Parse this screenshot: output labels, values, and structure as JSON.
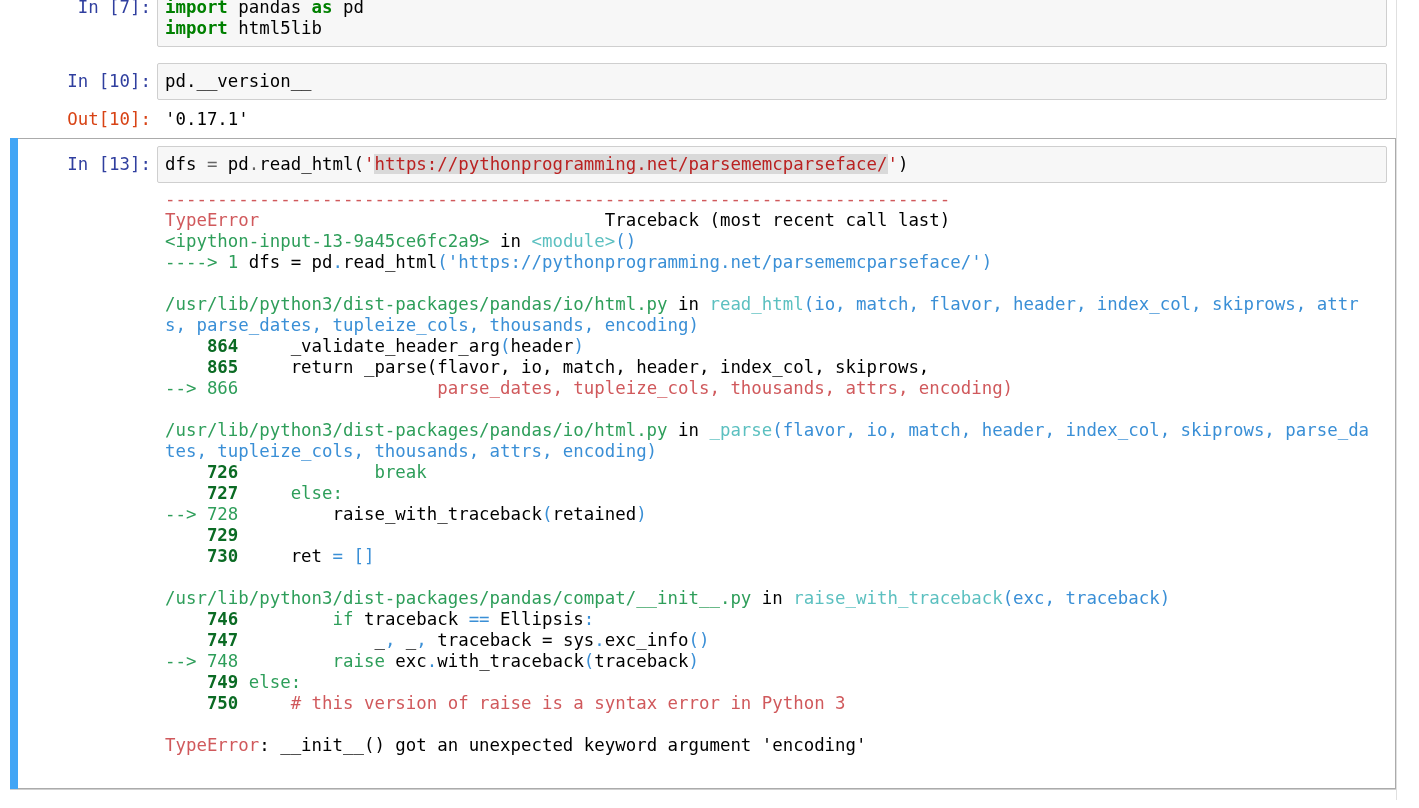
{
  "cells": [
    {
      "selected": false,
      "prompt": "In [7]:",
      "input": [
        [
          {
            "kind": "kw",
            "text": "import"
          },
          {
            "kind": "plain",
            "text": " pandas "
          },
          {
            "kind": "kw",
            "text": "as"
          },
          {
            "kind": "plain",
            "text": " pd"
          }
        ],
        [
          {
            "kind": "kw",
            "text": "import"
          },
          {
            "kind": "plain",
            "text": " html5lib"
          }
        ]
      ]
    },
    {
      "selected": false,
      "prompt": "In [10]:",
      "input": [
        [
          {
            "kind": "plain",
            "text": "pd."
          },
          {
            "kind": "plain",
            "text": "__version__"
          }
        ]
      ],
      "output": {
        "prompt": "Out[10]:",
        "lines": [
          "'0.17.1'"
        ]
      }
    },
    {
      "selected": true,
      "prompt": "In [13]:",
      "input": [
        [
          {
            "kind": "plain",
            "text": "dfs "
          },
          {
            "kind": "op",
            "text": "="
          },
          {
            "kind": "plain",
            "text": " pd"
          },
          {
            "kind": "op",
            "text": "."
          },
          {
            "kind": "plain",
            "text": "read_html("
          },
          {
            "kind": "str",
            "text": "'"
          },
          {
            "kind": "str-hl",
            "text": "https://pythonprogramming.net/parsememcparseface/"
          },
          {
            "kind": "str",
            "text": "'"
          },
          {
            "kind": "plain",
            "text": ")"
          }
        ]
      ],
      "traceback": [
        [
          [
            {
              "kind": "red",
              "text": "---------------------------------------------------------------------------"
            }
          ],
          [
            {
              "kind": "red",
              "text": "TypeError"
            },
            {
              "kind": "plain",
              "text": "                                 Traceback (most recent call last)"
            }
          ],
          [
            {
              "kind": "green",
              "text": "<ipython-input-13-9a45ce6fc2a9>"
            },
            {
              "kind": "plain",
              "text": " in "
            },
            {
              "kind": "cyan",
              "text": "<module>"
            },
            {
              "kind": "blue",
              "text": "()"
            }
          ],
          [
            {
              "kind": "green",
              "text": "----> 1"
            },
            {
              "kind": "plain",
              "text": " dfs = pd"
            },
            {
              "kind": "blue",
              "text": "."
            },
            {
              "kind": "plain",
              "text": "read_html"
            },
            {
              "kind": "blue",
              "text": "('https://pythonprogramming.net/parsememcparseface/')"
            }
          ]
        ],
        [
          [
            {
              "kind": "green",
              "text": "/usr/lib/python3/dist-packages/pandas/io/html.py"
            },
            {
              "kind": "plain",
              "text": " in "
            },
            {
              "kind": "cyan",
              "text": "read_html"
            },
            {
              "kind": "blue",
              "text": "(io, match, flavor, header, index_col, skiprows, attr"
            }
          ],
          [
            {
              "kind": "blue",
              "text": "s, parse_dates, tupleize_cols, thousands, encoding)"
            }
          ],
          [
            {
              "kind": "lineno",
              "text": "    864"
            },
            {
              "kind": "plain",
              "text": "     _validate_header_arg"
            },
            {
              "kind": "blue",
              "text": "("
            },
            {
              "kind": "plain",
              "text": "header"
            },
            {
              "kind": "blue",
              "text": ")"
            }
          ],
          [
            {
              "kind": "lineno",
              "text": "    865"
            },
            {
              "kind": "plain",
              "text": "     return _parse(flavor, io, match, header, index_col, skiprows,"
            }
          ],
          [
            {
              "kind": "green",
              "text": "--> 866"
            },
            {
              "kind": "red",
              "text": "                   parse_dates, tupleize_cols, thousands, attrs, encoding)"
            }
          ]
        ],
        [
          [
            {
              "kind": "green",
              "text": "/usr/lib/python3/dist-packages/pandas/io/html.py"
            },
            {
              "kind": "plain",
              "text": " in "
            },
            {
              "kind": "cyan",
              "text": "_parse"
            },
            {
              "kind": "blue",
              "text": "(flavor, io, match, header, index_col, skiprows, parse_da"
            }
          ],
          [
            {
              "kind": "blue",
              "text": "tes, tupleize_cols, thousands, attrs, encoding)"
            }
          ],
          [
            {
              "kind": "lineno",
              "text": "    726"
            },
            {
              "kind": "green",
              "text": "             break"
            }
          ],
          [
            {
              "kind": "lineno",
              "text": "    727"
            },
            {
              "kind": "green",
              "text": "     else:"
            }
          ],
          [
            {
              "kind": "green",
              "text": "--> 728"
            },
            {
              "kind": "plain",
              "text": "         raise_with_traceback"
            },
            {
              "kind": "blue",
              "text": "("
            },
            {
              "kind": "plain",
              "text": "retained"
            },
            {
              "kind": "blue",
              "text": ")"
            }
          ],
          [
            {
              "kind": "lineno",
              "text": "    729"
            }
          ],
          [
            {
              "kind": "lineno",
              "text": "    730"
            },
            {
              "kind": "plain",
              "text": "     ret "
            },
            {
              "kind": "blue",
              "text": "= []"
            }
          ]
        ],
        [
          [
            {
              "kind": "green",
              "text": "/usr/lib/python3/dist-packages/pandas/compat/__init__.py"
            },
            {
              "kind": "plain",
              "text": " in "
            },
            {
              "kind": "cyan",
              "text": "raise_with_traceback"
            },
            {
              "kind": "blue",
              "text": "(exc, traceback)"
            }
          ],
          [
            {
              "kind": "lineno",
              "text": "    746"
            },
            {
              "kind": "green",
              "text": "         if"
            },
            {
              "kind": "plain",
              "text": " traceback "
            },
            {
              "kind": "blue",
              "text": "=="
            },
            {
              "kind": "plain",
              "text": " Ellipsis"
            },
            {
              "kind": "blue",
              "text": ":"
            }
          ],
          [
            {
              "kind": "lineno",
              "text": "    747"
            },
            {
              "kind": "plain",
              "text": "             _"
            },
            {
              "kind": "blue",
              "text": ","
            },
            {
              "kind": "plain",
              "text": " _"
            },
            {
              "kind": "blue",
              "text": ","
            },
            {
              "kind": "plain",
              "text": " traceback = sys"
            },
            {
              "kind": "blue",
              "text": "."
            },
            {
              "kind": "plain",
              "text": "exc_info"
            },
            {
              "kind": "blue",
              "text": "()"
            }
          ],
          [
            {
              "kind": "green",
              "text": "--> 748"
            },
            {
              "kind": "green",
              "text": "         raise"
            },
            {
              "kind": "plain",
              "text": " exc"
            },
            {
              "kind": "blue",
              "text": "."
            },
            {
              "kind": "plain",
              "text": "with_traceback"
            },
            {
              "kind": "blue",
              "text": "("
            },
            {
              "kind": "plain",
              "text": "traceback"
            },
            {
              "kind": "blue",
              "text": ")"
            }
          ],
          [
            {
              "kind": "lineno",
              "text": "    749"
            },
            {
              "kind": "green",
              "text": " else:"
            }
          ],
          [
            {
              "kind": "lineno",
              "text": "    750"
            },
            {
              "kind": "red",
              "text": "     # this version of raise is a syntax error in Python 3"
            }
          ]
        ],
        [
          [
            {
              "kind": "red",
              "text": "TypeError"
            },
            {
              "kind": "plain",
              "text": ": __init__() got an unexpected keyword argument 'encoding'"
            }
          ]
        ]
      ]
    }
  ]
}
